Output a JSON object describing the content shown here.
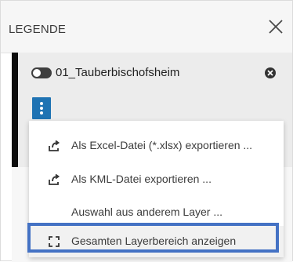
{
  "legend": {
    "title": "LEGENDE",
    "close_icon": "close-icon"
  },
  "layer": {
    "name": "01_Tauberbischofsheim",
    "visible": true,
    "toggle_icon": "toggle-switch-icon",
    "remove_icon": "remove-circle-icon",
    "menu_icon": "kebab-menu-icon"
  },
  "menu": {
    "items": [
      {
        "label": "Als Excel-Datei (*.xlsx) exportieren ...",
        "icon": "export-icon"
      },
      {
        "label": "Als KML-Datei exportieren ...",
        "icon": "export-icon"
      },
      {
        "label": "Auswahl aus anderem Layer ...",
        "icon": ""
      },
      {
        "label": "Gesamten Layerbereich anzeigen",
        "icon": "zoom-extent-icon"
      }
    ],
    "highlighted_index": 3
  },
  "colors": {
    "accent_blue": "#1f73b3",
    "focus_outline": "#4472c4",
    "layer_bar": "#0d0d0d"
  }
}
